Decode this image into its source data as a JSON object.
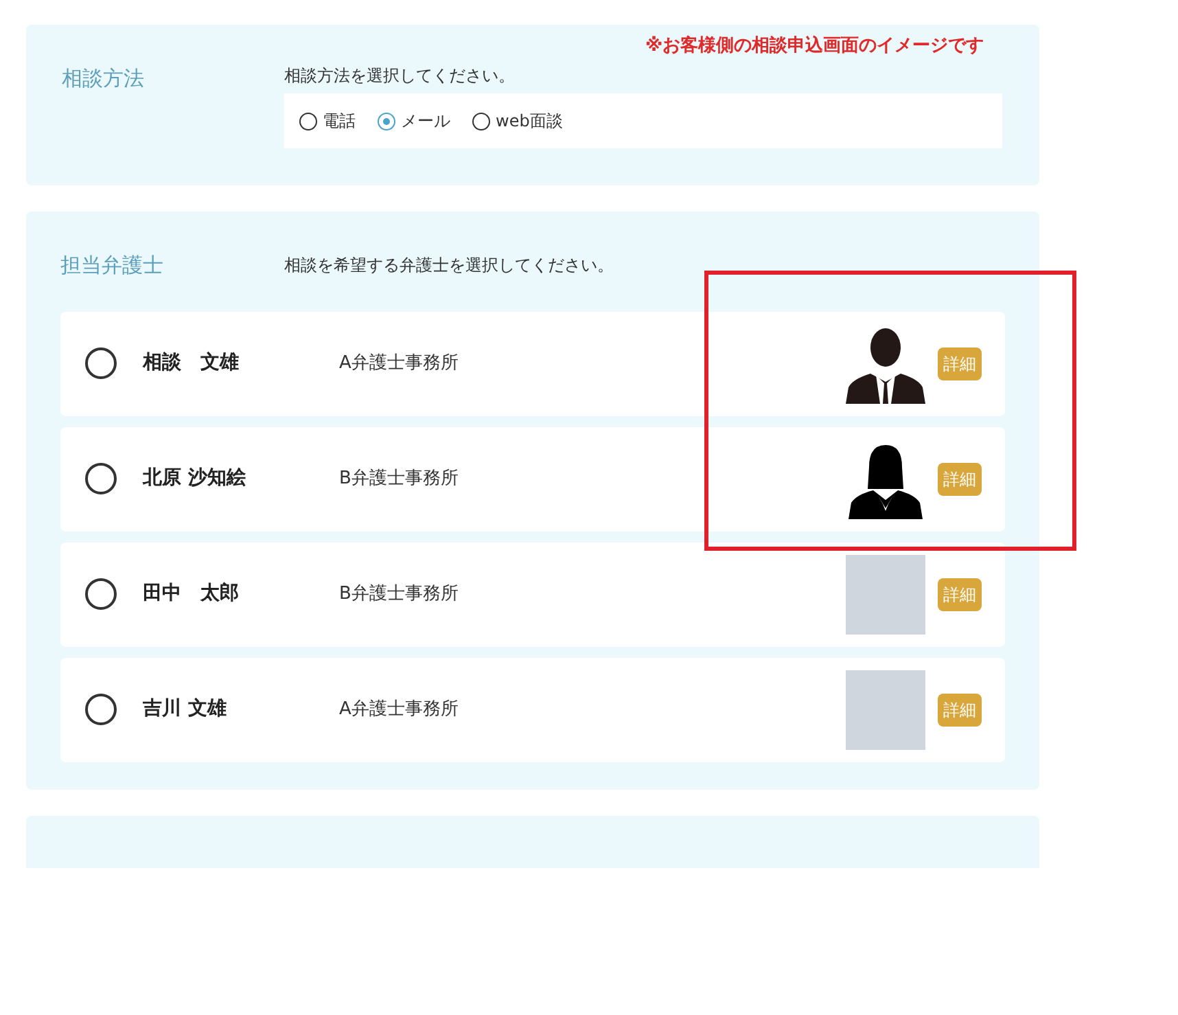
{
  "notice": "※お客様側の相談申込画面のイメージです",
  "method": {
    "label": "相談方法",
    "instruction": "相談方法を選択してください。",
    "options": [
      {
        "label": "電話",
        "selected": false
      },
      {
        "label": "メール",
        "selected": true
      },
      {
        "label": "web面談",
        "selected": false
      }
    ]
  },
  "lawyer": {
    "label": "担当弁護士",
    "instruction": "相談を希望する弁護士を選択してください。",
    "rows": [
      {
        "name": "相談　文雄",
        "office": "A弁護士事務所",
        "selected": false,
        "kind": "male",
        "button": "詳細"
      },
      {
        "name": "北原 沙知絵",
        "office": "B弁護士事務所",
        "selected": false,
        "kind": "female",
        "button": "詳細"
      },
      {
        "name": "田中　太郎",
        "office": "B弁護士事務所",
        "selected": false,
        "kind": "photo",
        "button": "詳細"
      },
      {
        "name": "吉川 文雄",
        "office": "A弁護士事務所",
        "selected": false,
        "kind": "photo",
        "button": "詳細"
      }
    ]
  }
}
